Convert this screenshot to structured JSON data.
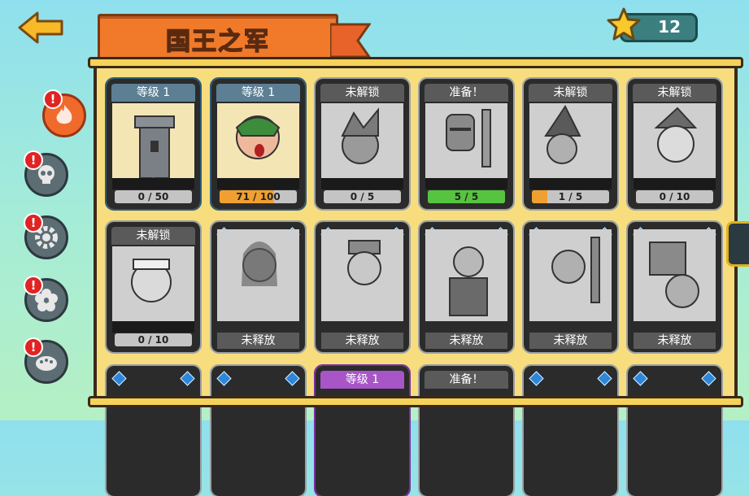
{
  "header": {
    "title": "国王之军",
    "star_total": "12"
  },
  "colors": {
    "banner": "#f07a2a",
    "panel": "#f7dd7e",
    "progress": "#f0a030",
    "ready": "#56c440"
  },
  "side_tabs": [
    {
      "name": "fire",
      "active": true,
      "alert": "!"
    },
    {
      "name": "skull",
      "active": false,
      "alert": "!"
    },
    {
      "name": "gear",
      "active": false,
      "alert": "!"
    },
    {
      "name": "flower",
      "active": false,
      "alert": "!"
    },
    {
      "name": "shell",
      "active": false,
      "alert": "!"
    }
  ],
  "cards": [
    {
      "header": "等级 1",
      "progress": "0 / 50",
      "stars": "★",
      "state": "unlocked"
    },
    {
      "header": "等级 1",
      "progress": "71 / 100",
      "stars": "★★",
      "state": "unlocked",
      "fill": 0.71
    },
    {
      "header": "未解锁",
      "progress": "0 / 5",
      "state": "locked"
    },
    {
      "header": "准备！",
      "progress": "5 / 5",
      "state": "ready",
      "fill": 1.0
    },
    {
      "header": "未解锁",
      "progress": "1 / 5",
      "state": "locked",
      "fill": 0.2
    },
    {
      "header": "未解锁",
      "progress": "0 / 10",
      "state": "locked"
    },
    {
      "header": "未解锁",
      "progress": "0 / 10",
      "state": "locked"
    },
    {
      "footer": "未释放",
      "state": "gem"
    },
    {
      "footer": "未释放",
      "state": "gem"
    },
    {
      "footer": "未释放",
      "state": "gem"
    },
    {
      "footer": "未释放",
      "state": "gem"
    },
    {
      "footer": "未释放",
      "state": "gem"
    },
    {
      "state": "gem"
    },
    {
      "state": "gem"
    },
    {
      "header": "等级 1",
      "state": "purple"
    },
    {
      "header": "准备！",
      "state": "ready"
    },
    {
      "state": "gem"
    },
    {
      "state": "gem"
    }
  ]
}
